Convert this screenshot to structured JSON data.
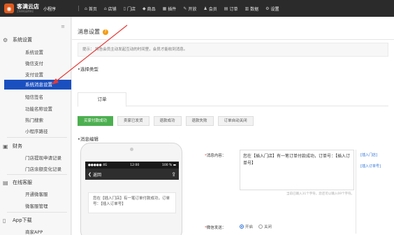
{
  "brand": {
    "name": "客满云店",
    "tagline": "正版授权品质保证",
    "mini": "小程序"
  },
  "nav": [
    {
      "icon": "home-icon",
      "glyph": "⌂",
      "label": "首页"
    },
    {
      "icon": "store-icon",
      "glyph": "⌂",
      "label": "店铺"
    },
    {
      "icon": "shop-icon",
      "glyph": "▯",
      "label": "门店"
    },
    {
      "icon": "goods-icon",
      "glyph": "◆",
      "label": "商品"
    },
    {
      "icon": "plugin-icon",
      "glyph": "▦",
      "label": "插件"
    },
    {
      "icon": "marketing-icon",
      "glyph": "✎",
      "label": "开放"
    },
    {
      "icon": "member-icon",
      "glyph": "♟",
      "label": "会员"
    },
    {
      "icon": "order-icon",
      "glyph": "▤",
      "label": "订单"
    },
    {
      "icon": "data-icon",
      "glyph": "▥",
      "label": "数据"
    },
    {
      "icon": "settings-icon",
      "glyph": "⚙",
      "label": "设置"
    }
  ],
  "sidebar": {
    "collapse_glyph": "≡",
    "group_system": "系统设置",
    "items_system": [
      "系统设置",
      "微信支付",
      "支付设置",
      "系统消息设置",
      "短信签名",
      "功能名称设置",
      "热门搜索",
      "小程序路径"
    ],
    "group_finance": "财务",
    "items_finance": [
      "门店提现申请记录",
      "门店余额变化记录"
    ],
    "group_service": "在线客服",
    "items_service": [
      "开通微客服",
      "微客服管理"
    ],
    "group_app": "App下载",
    "items_app": [
      "商家APP"
    ]
  },
  "main": {
    "title": "消息设置",
    "tip": "提示：   将告会员主动发起互动的时间里，会员才能收到消息。",
    "section_type": "•选择类型",
    "tab": "订单",
    "filters": [
      "买家付款成功",
      "卖家已发货",
      "退款成功",
      "退款失败",
      "订单自动关闭"
    ],
    "section_edit": "•消息编辑"
  },
  "phone": {
    "carrier": "●●●●● 4G",
    "time": "12:00",
    "battery": "100 % ▬",
    "back": "返回",
    "message": "您在【插入门店】有一笔订单付款成功，订单号：【插入订单号】"
  },
  "editor": {
    "label_content": "消息内容：",
    "content": "您在【插入门店】有一笔订单付款成功，订单号：【插入订单号】",
    "hint": "当前已输入31个字符，您还可以输入69个字符。",
    "insert_store": "[插入门店]",
    "insert_order": "[插入订单号]",
    "label_wechat": "微信发送：",
    "opt_on": "开启",
    "opt_off": "关闭"
  }
}
